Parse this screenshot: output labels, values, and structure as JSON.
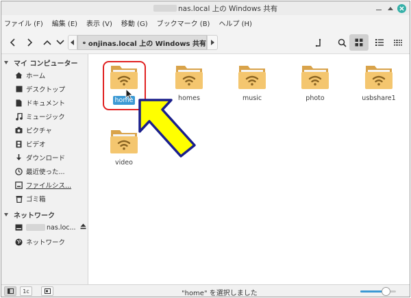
{
  "window": {
    "title": "nas.local 上の Windows 共有"
  },
  "menubar": {
    "items": [
      "ファイル (F)",
      "編集 (E)",
      "表示 (V)",
      "移動 (G)",
      "ブックマーク (B)",
      "ヘルプ (H)"
    ]
  },
  "toolbar": {
    "location": "onjinas.local 上の Windows 共有"
  },
  "sidebar": {
    "computer_header": "マイ コンピューター",
    "computer_items": [
      "ホーム",
      "デスクトップ",
      "ドキュメント",
      "ミュージック",
      "ピクチャ",
      "ビデオ",
      "ダウンロード",
      "最近使った...",
      "ファイルシス...",
      "ゴミ箱"
    ],
    "network_header": "ネットワーク",
    "network_items": [
      "nas.loc...",
      "ネットワーク"
    ]
  },
  "folders": [
    {
      "name": "home",
      "selected": true
    },
    {
      "name": "homes",
      "selected": false
    },
    {
      "name": "music",
      "selected": false
    },
    {
      "name": "photo",
      "selected": false
    },
    {
      "name": "usbshare1",
      "selected": false
    },
    {
      "name": "video",
      "selected": false
    }
  ],
  "statusbar": {
    "text": "\"home\" を選択しました",
    "button2": "1c",
    "zoom_fraction": 0.72
  },
  "colors": {
    "folder_body": "#f4c66f",
    "folder_back": "#d9a34a",
    "selection": "#3b99d4",
    "highlight_ring": "#e02020",
    "arrow_fill": "#ffff00",
    "close_button": "#35b0a8"
  }
}
